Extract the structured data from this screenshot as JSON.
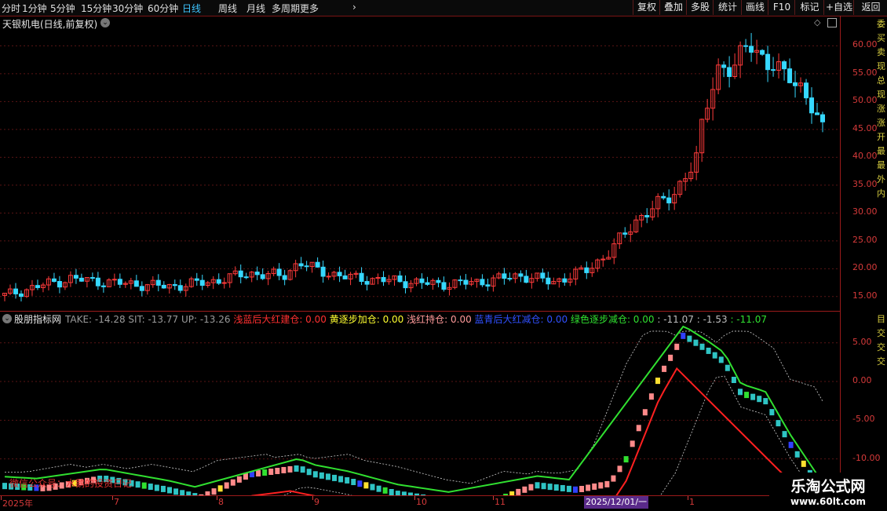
{
  "toolbar": {
    "periods": [
      "分时",
      "1分钟",
      "5分钟",
      "15分钟",
      "30分钟",
      "60分钟",
      "日线",
      "周线",
      "月线",
      "多周期",
      "更多"
    ],
    "active": "日线",
    "buttons": [
      "复权",
      "叠加",
      "多股",
      "统计",
      "画线",
      "F10",
      "标记",
      "+自选",
      "返回"
    ]
  },
  "main": {
    "title": "天银机电(日线,前复权)",
    "y_labels": [
      "60.00",
      "55.00",
      "50.00",
      "45.00",
      "40.00",
      "35.00",
      "30.00",
      "25.00",
      "20.00",
      "15.00"
    ],
    "right_strip": "委买卖现总现涨涨开最最外内"
  },
  "indicator": {
    "name": "股朋指标网",
    "values": [
      {
        "text": "TAKE: -14.28",
        "color": "#9a9a9a"
      },
      {
        "text": "SIT: -13.77",
        "color": "#9a9a9a"
      },
      {
        "text": "UP: -13.26",
        "color": "#9a9a9a"
      },
      {
        "text": "浅蓝后大红建仓: 0.00",
        "color": "#ff3030"
      },
      {
        "text": "黄逐步加仓: 0.00",
        "color": "#ffff30"
      },
      {
        "text": "浅红持仓: 0.00",
        "color": "#ff9a9a"
      },
      {
        "text": "蓝青后大红减仓: 0.00",
        "color": "#3050ff"
      },
      {
        "text": "绿色逐步减仓: 0.00",
        "color": "#30e030"
      },
      {
        "text": ": -11.07",
        "color": "#bdbdbd"
      },
      {
        "text": ": -1.53",
        "color": "#bdbdbd"
      },
      {
        "text": ": -11.07",
        "color": "#30e030"
      }
    ],
    "y_labels": [
      "5.00",
      "0.00",
      "-5.00",
      "-10.00"
    ],
    "right_strip": "目交交交",
    "wechat_note": "微信公众号：水鹅的投资日记"
  },
  "date_axis": {
    "labels": [
      "2025年",
      "7",
      "8",
      "9",
      "10",
      "11",
      "1"
    ],
    "cursor_date": "2025/12/01/一"
  },
  "watermark": {
    "line1": "乐淘公式网",
    "line2": "www.60lt.com"
  },
  "colors": {
    "up_candle": "#ff3b3b",
    "down_candle": "#36d8ff",
    "grid": "#5a1414",
    "accent": "#3fc5ff"
  },
  "chart_data": [
    {
      "type": "candlestick",
      "title": "天银机电(日线,前复权)",
      "ylim": [
        13,
        64
      ],
      "y_ticks": [
        15,
        20,
        25,
        30,
        35,
        40,
        45,
        50,
        55,
        60
      ],
      "x": [
        "2025-06",
        "2025-07",
        "2025-08",
        "2025-09",
        "2025-10",
        "2025-11",
        "2025-12",
        "2026-01"
      ],
      "close_path": [
        [
          0,
          15.2
        ],
        [
          0.05,
          17.2
        ],
        [
          0.08,
          18.2
        ],
        [
          0.13,
          17.5
        ],
        [
          0.2,
          16.8
        ],
        [
          0.25,
          17.6
        ],
        [
          0.3,
          19.2
        ],
        [
          0.34,
          18.6
        ],
        [
          0.36,
          21.2
        ],
        [
          0.38,
          19.8
        ],
        [
          0.42,
          18.4
        ],
        [
          0.48,
          17.8
        ],
        [
          0.53,
          17.2
        ],
        [
          0.58,
          17.6
        ],
        [
          0.63,
          18.8
        ],
        [
          0.67,
          17.6
        ],
        [
          0.71,
          19.6
        ],
        [
          0.74,
          23.0
        ],
        [
          0.77,
          28.5
        ],
        [
          0.79,
          30.5
        ],
        [
          0.82,
          34.0
        ],
        [
          0.845,
          39.0
        ],
        [
          0.855,
          48.0
        ],
        [
          0.87,
          56.0
        ],
        [
          0.89,
          55.0
        ],
        [
          0.91,
          62.0
        ],
        [
          0.93,
          56.0
        ],
        [
          0.96,
          55.5
        ],
        [
          0.98,
          50.0
        ],
        [
          1.0,
          45.6
        ]
      ],
      "last_close": 45.6
    },
    {
      "type": "line",
      "title": "股朋指标网",
      "ylim": [
        -14.5,
        7
      ],
      "y_ticks": [
        5,
        0,
        -5,
        -10
      ],
      "series": [
        {
          "name": "TAKE",
          "last": -14.28
        },
        {
          "name": "SIT",
          "last": -13.77
        },
        {
          "name": "UP",
          "last": -13.26
        }
      ],
      "path": [
        [
          0,
          -13.5
        ],
        [
          0.05,
          -13.8
        ],
        [
          0.12,
          -12.5
        ],
        [
          0.2,
          -14.0
        ],
        [
          0.24,
          -15.0
        ],
        [
          0.3,
          -12.0
        ],
        [
          0.36,
          -11.2
        ],
        [
          0.38,
          -12.0
        ],
        [
          0.42,
          -12.8
        ],
        [
          0.48,
          -14.5
        ],
        [
          0.55,
          -15.6
        ],
        [
          0.6,
          -15.4
        ],
        [
          0.65,
          -13.4
        ],
        [
          0.7,
          -14.0
        ],
        [
          0.74,
          -13.2
        ],
        [
          0.76,
          -10.0
        ],
        [
          0.8,
          0.5
        ],
        [
          0.83,
          6.0
        ],
        [
          0.86,
          4.0
        ],
        [
          0.88,
          2.5
        ],
        [
          0.9,
          -1.5
        ],
        [
          0.93,
          -2.5
        ],
        [
          0.96,
          -8.0
        ],
        [
          1.0,
          -14.28
        ]
      ]
    }
  ]
}
